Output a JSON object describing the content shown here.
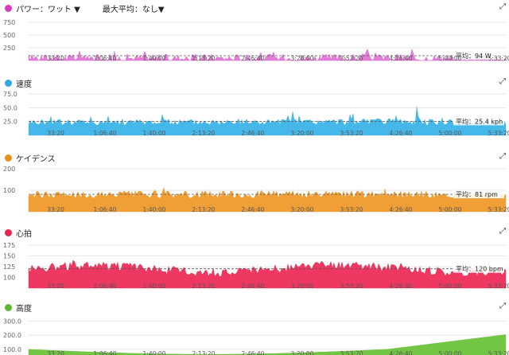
{
  "chart_data": [
    {
      "type": "area",
      "id": "power",
      "label": "パワー：ワット ▼",
      "selector": "最大平均：なし▼",
      "color": "#d63cc0",
      "fill": "#e07ad4",
      "yticks": [
        "750",
        "500",
        "250"
      ],
      "ylim": [
        0,
        750
      ],
      "base": 45,
      "amp": 85,
      "spikes": 230,
      "avg": 94,
      "avg_label": "平均：94 W",
      "xticks": [
        "33:20",
        "1:06:40",
        "1:40:00",
        "2:13:20",
        "2:46:40",
        "3:20:00",
        "3:53:20",
        "4:26:40",
        "5:00:00",
        "5:33:20"
      ]
    },
    {
      "type": "area",
      "id": "speed",
      "label": "速度",
      "color": "#2ea8e0",
      "fill": "#3db4e8",
      "yticks": [
        "75.0",
        "50.0",
        "25.0"
      ],
      "ylim": [
        0,
        75
      ],
      "base": 24,
      "amp": 6,
      "spikes": 30,
      "avg": 25.4,
      "avg_label": "平均：25.4 kph",
      "xticks": [
        "33:20",
        "1:06:40",
        "1:40:00",
        "2:13:20",
        "2:46:40",
        "3:20:00",
        "3:53:20",
        "4:26:40",
        "5:00:00",
        "5:33:20"
      ]
    },
    {
      "type": "area",
      "id": "cadence",
      "label": "ケイデンス",
      "color": "#e8901c",
      "fill": "#ef9a2c",
      "yticks": [
        "200",
        "100"
      ],
      "ylim": [
        0,
        200
      ],
      "base": 80,
      "amp": 18,
      "spikes": 20,
      "avg": 81,
      "avg_label": "平均：81 rpm",
      "xticks": [
        "33:20",
        "1:06:40",
        "1:40:00",
        "2:13:20",
        "2:46:40",
        "3:20:00",
        "3:53:20",
        "4:26:40",
        "5:00:00",
        "5:33:20"
      ]
    },
    {
      "type": "area",
      "id": "heartrate",
      "label": "心拍",
      "color": "#e6244e",
      "fill": "#ee2e5a",
      "yticks": [
        "175",
        "150",
        "125",
        "100"
      ],
      "ylim": [
        75,
        175
      ],
      "base": 120,
      "amp": 10,
      "spikes": 15,
      "avg": 120,
      "avg_label": "平均：120 bpm",
      "xticks": [
        "33:20",
        "1:06:40",
        "1:40:00",
        "2:13:20",
        "2:46:40",
        "3:20:00",
        "3:53:20",
        "4:26:40",
        "5:00:00",
        "5:33:20"
      ]
    },
    {
      "type": "area",
      "id": "altitude",
      "label": "高度",
      "color": "#5cb82c",
      "fill": "#6cc33a",
      "yticks": [
        "300.0",
        "200.0",
        "100.0"
      ],
      "ylim": [
        60,
        320
      ],
      "base": 110,
      "amp": 0,
      "spikes": 0,
      "avg": null,
      "avg_label": "",
      "xticks": [
        "33:20",
        "1:06:40",
        "1:40:00",
        "2:13:20",
        "2:46:40",
        "3:20:00",
        "3:53:20",
        "4:26:40",
        "5:00:00",
        "5:33:20"
      ]
    }
  ]
}
